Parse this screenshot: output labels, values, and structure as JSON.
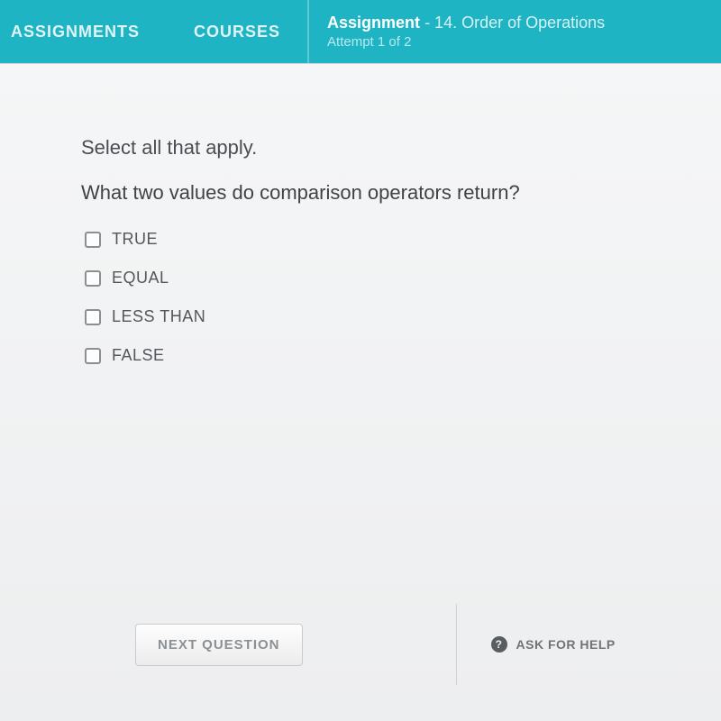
{
  "header": {
    "nav": [
      {
        "label": "ASSIGNMENTS"
      },
      {
        "label": "COURSES"
      }
    ],
    "assignment_label": "Assignment",
    "assignment_name": " - 14. Order of Operations",
    "attempt": "Attempt 1 of 2"
  },
  "instruction": "Select all that apply.",
  "question": "What two values do comparison operators return?",
  "options": [
    {
      "label": "TRUE"
    },
    {
      "label": "EQUAL"
    },
    {
      "label": "LESS THAN"
    },
    {
      "label": "FALSE"
    }
  ],
  "buttons": {
    "next": "NEXT QUESTION",
    "ask_help": "ASK FOR HELP",
    "ask_help_icon": "?"
  }
}
